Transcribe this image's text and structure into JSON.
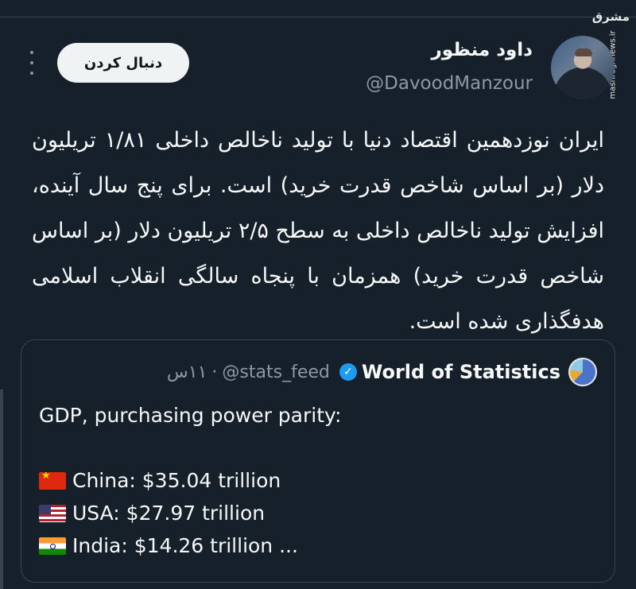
{
  "watermark": {
    "logo": "مشرق",
    "url": "mashreghnews.ir"
  },
  "author": {
    "display_name": "داود منظور",
    "handle": "@DavoodManzour"
  },
  "follow_label": "دنبال کردن",
  "tweet": {
    "text": "ایران نوزدهمین اقتصاد دنیا با تولید ناخالص داخلی ۱/۸۱ تریلیون دلار (بر اساس شاخص قدرت خرید) است. برای پنج سال آینده، افزایش تولید ناخالص داخلی به سطح ۲/۵ تریلیون دلار (بر اساس شاخص قدرت خرید) همزمان با پنجاه سالگی انقلاب اسلامی هدفگذاری شده است."
  },
  "quote": {
    "name": "World of Statistics",
    "handle": "@stats_feed",
    "separator": "·",
    "time": "۱۱س",
    "title_line": "GDP, purchasing power parity:",
    "items": [
      {
        "flag": "china-flag",
        "text": "China: $35.04 trillion"
      },
      {
        "flag": "usa-flag",
        "text": "USA: $27.97 trillion"
      },
      {
        "flag": "india-flag",
        "text": "India: $14.26 trillion ..."
      }
    ]
  },
  "colors": {
    "background": "#15202b",
    "text": "#f7f9f9",
    "muted": "#8b98a5",
    "verified": "#1d9bf0",
    "border": "#38444d"
  }
}
